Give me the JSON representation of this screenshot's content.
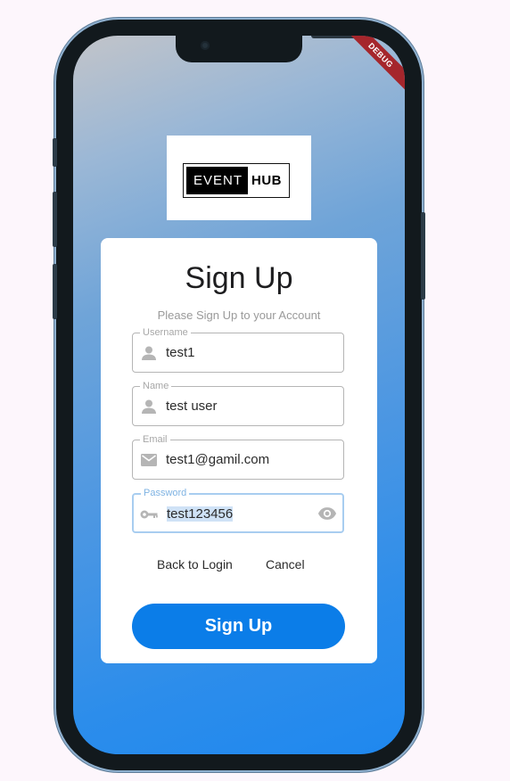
{
  "app": {
    "debug_banner": "DEBUG",
    "logo": {
      "part1": "EVENT",
      "part2": "HUB"
    }
  },
  "form": {
    "title": "Sign Up",
    "subtitle": "Please Sign Up to your Account",
    "fields": [
      {
        "label": "Username",
        "value": "test1",
        "icon": "person-icon"
      },
      {
        "label": "Name",
        "value": "test user",
        "icon": "person-icon"
      },
      {
        "label": "Email",
        "value": "test1@gamil.com",
        "icon": "mail-icon"
      },
      {
        "label": "Password",
        "value": "test123456",
        "icon": "key-icon",
        "focused": true,
        "selected": true
      }
    ],
    "back_to_login_label": "Back to Login",
    "cancel_label": "Cancel",
    "submit_label": "Sign Up"
  },
  "colors": {
    "accent": "#0b7de8",
    "focus_border": "#a8cdf0",
    "debug_banner": "#a5262c"
  }
}
